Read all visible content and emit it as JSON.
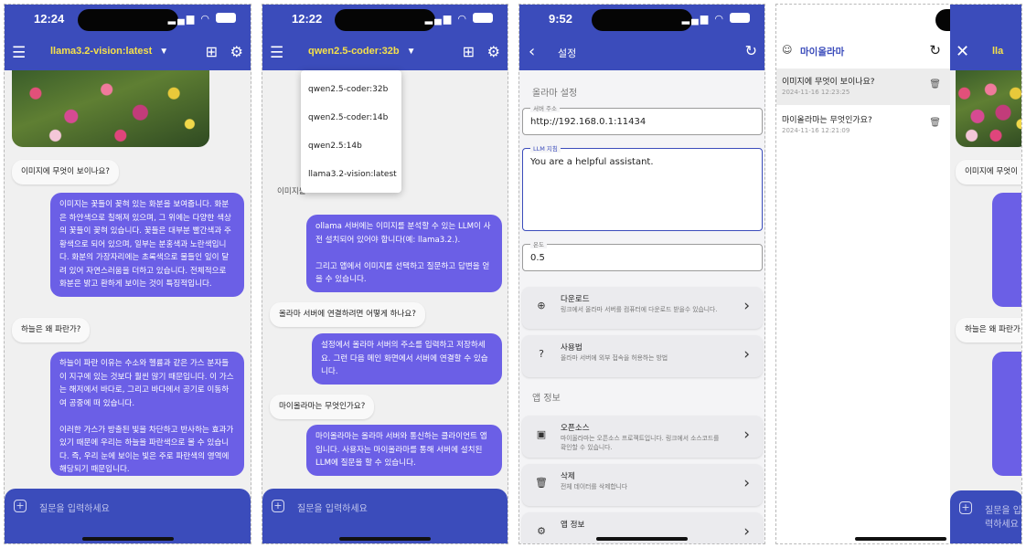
{
  "screens": [
    {
      "time": "12:24",
      "model": "llama3.2-vision:latest",
      "input_placeholder": "질문을 입력하세요",
      "messages": [
        {
          "role": "user",
          "text": "이미지에 무엇이 보이나요?"
        },
        {
          "role": "assistant",
          "text": "이미지는 꽃들이 꽂혀 있는 화분을 보여줍니다. 화분은 하얀색으로 칠해져 있으며, 그 위에는 다양한 색상의 꽃들이 꽂혀 있습니다. 꽃들은 대부분 빨간색과 주황색으로 되어 있으며, 일부는 분홍색과 노란색입니다. 화분의 가장자리에는 초록색으로 물들인 잎이 달려 있어 자연스러움을 더하고 있습니다. 전체적으로 화분은 밝고 환하게 보이는 것이 특징적입니다."
        },
        {
          "role": "user",
          "text": "하늘은 왜 파란가?"
        },
        {
          "role": "assistant",
          "text": "하늘이 파란 이유는 수소와 헬륨과 같은 가스 분자들이 지구에 있는 것보다 훨씬 많기 때문입니다. 이 가스는 해저에서 바다로, 그리고 바다에서 공기로 이동하여 공중에 떠 있습니다.\n\n이러한 가스가 방출된 빛을 차단하고 반사하는 효과가 있기 때문에 우리는 하늘을 파란색으로 볼 수 있습니다. 즉, 우리 눈에 보이는 빛은 주로 파란색의 영역에 해당되기 때문입니다."
        }
      ]
    },
    {
      "time": "12:22",
      "model": "qwen2.5-coder:32b",
      "input_placeholder": "질문을 입력하세요",
      "dropdown_options": [
        "qwen2.5-coder:32b",
        "qwen2.5-coder:14b",
        "qwen2.5:14b",
        "llama3.2-vision:latest"
      ],
      "peek_text": "이미지를",
      "messages": [
        {
          "role": "assistant",
          "text": "ollama 서버에는 이미지를 분석할 수 있는 LLM이 사전 설치되어 있어야 합니다(예: llama3.2.).\n\n그리고 앱에서 이미지를 선택하고 질문하고 답변을 얻을 수 있습니다."
        },
        {
          "role": "user",
          "text": "올라마 서버에 연결하려면 어떻게 하나요?"
        },
        {
          "role": "assistant",
          "text": "설정에서 올라마 서버의 주소를 입력하고 저장하세요. 그런 다음 메인 화면에서 서버에 연결할 수 있습니다."
        },
        {
          "role": "user",
          "text": "마이올라마는 무엇인가요?"
        },
        {
          "role": "assistant",
          "text": "마이올라마는 올라마 서버와 통신하는 클라이언트 앱입니다. 사용자는 마이올라마를 통해 서버에 설치된 LLM에 질문을 할 수 있습니다."
        }
      ]
    }
  ],
  "settings": {
    "time": "9:52",
    "title": "설정",
    "section_ollama": "올라마 설정",
    "server_label": "서버 주소",
    "server_value": "http://192.168.0.1:11434",
    "prompt_label": "LLM 지침",
    "prompt_value": "You are a helpful assistant.",
    "temp_label": "온도",
    "temp_value": "0.5",
    "cards_top": [
      {
        "title": "다운로드",
        "desc": "링크에서 올라마 서버를 컴퓨터에 다운로드 받을수 있습니다.",
        "icon": "download-icon"
      },
      {
        "title": "사용법",
        "desc": "올라마 서버에 외부 접속을 허용하는 방법",
        "icon": "help-icon"
      }
    ],
    "section_app": "앱 정보",
    "cards_bottom": [
      {
        "title": "오픈소스",
        "desc": "마이올라마는 오픈소스 프로젝트입니다. 링크에서 소스코드를 확인할 수 있습니다.",
        "icon": "chip-icon"
      },
      {
        "title": "삭제",
        "desc": "전체 데이터를 삭제합니다",
        "icon": "delete-icon"
      },
      {
        "title": "앱 정보",
        "desc": "",
        "icon": "info-icon"
      }
    ]
  },
  "history": {
    "title": "마이올라마",
    "items": [
      {
        "question": "이미지에 무엇이 보이나요?",
        "date": "2024-11-16 12:23:25"
      },
      {
        "question": "마이올라마는 무엇인가요?",
        "date": "2024-11-16 12:21:09"
      }
    ],
    "peek_texts": [
      "이미지에 무엇이",
      "하늘은 왜 파란가"
    ]
  },
  "colors": {
    "primary": "#3b4cbb",
    "bubble": "#6b5fe6",
    "model": "#f5e04a"
  }
}
